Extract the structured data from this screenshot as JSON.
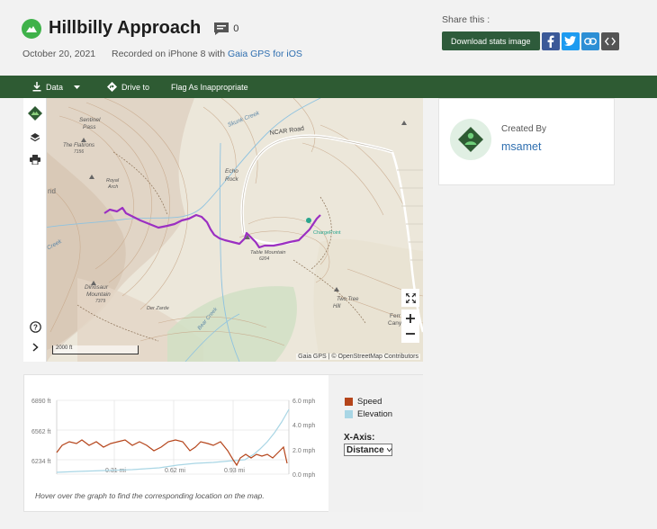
{
  "header": {
    "title": "Hillbilly Approach",
    "comment_count": "0",
    "date": "October 20, 2021",
    "recorded_prefix": "Recorded on iPhone 8 with",
    "app_link": "Gaia GPS for iOS"
  },
  "share": {
    "label": "Share this :",
    "download_label": "Download stats image",
    "buttons": [
      "facebook-icon",
      "twitter-icon",
      "link-icon",
      "code-icon"
    ]
  },
  "nav": {
    "items": [
      {
        "label": "Data",
        "icon": "download-icon"
      },
      {
        "label": "Drive to",
        "icon": "directions-icon"
      },
      {
        "label": "Flag As Inappropriate",
        "icon": ""
      }
    ]
  },
  "map": {
    "attribution": "Gaia GPS | © OpenStreetMap Contributors",
    "scale_label": "2000 ft",
    "labels": {
      "sentinel": "Sentinel",
      "pass": "Pass",
      "flatirons": "The Flatirons",
      "flat_elev": "7156",
      "royal": "Royal",
      "arch": "Arch",
      "skunk_creek": "Skunk Creek",
      "ncar_road": "NCAR Road",
      "echo": "Echo",
      "rock": "Rock",
      "skunk_creek2": "Skunk Creek",
      "table_mountain": "Table Mountain",
      "tm_elev": "6204",
      "charge_point": "ChargePoint",
      "two_tree": "Two Tree",
      "hill": "Hill",
      "dinosaur": "Dinosaur",
      "mountain": "Mountain",
      "dm_elev": "7379",
      "der_zarde": "Der Zarde",
      "bear_creek": "Bear Creek",
      "ferr": "Ferr",
      "canyo": "Canyo",
      "nd": "nd"
    }
  },
  "creator": {
    "label": "Created By",
    "name": "msamet"
  },
  "graph": {
    "legend": [
      {
        "name": "Speed",
        "color": "#b5451b"
      },
      {
        "name": "Elevation",
        "color": "#a9d6e5"
      }
    ],
    "xaxis_label": "X-Axis:",
    "xaxis_value": "Distance",
    "left_ticks": [
      "6890 ft",
      "6562 ft",
      "6234 ft"
    ],
    "right_ticks": [
      "6.0 mph",
      "4.0 mph",
      "2.0 mph",
      "0.0 mph"
    ],
    "x_ticks": [
      "0.31 mi",
      "0.62 mi",
      "0.93 mi"
    ],
    "hover_note": "Hover over the graph to find the corresponding location on the map."
  },
  "colors": {
    "nav_bg": "#2e5b33",
    "brand_green": "#3fb24a",
    "track": "#9b2fc2",
    "link": "#2f6fb0"
  }
}
